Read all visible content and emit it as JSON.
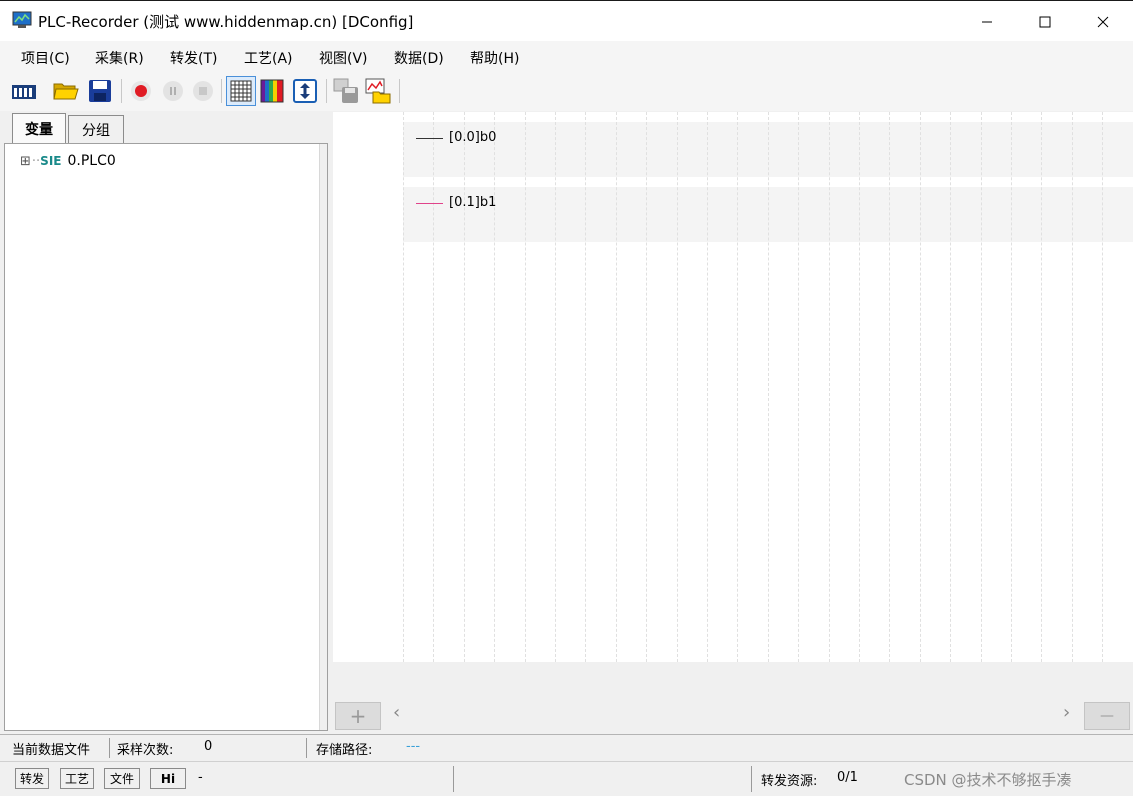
{
  "window": {
    "title": "PLC-Recorder (测试 www.hiddenmap.cn) [DConfig]",
    "minimize_glyph": "—",
    "maximize_glyph": "☐",
    "close_glyph": "✕"
  },
  "menu": [
    "项目(C)",
    "采集(R)",
    "转发(T)",
    "工艺(A)",
    "视图(V)",
    "数据(D)",
    "帮助(H)"
  ],
  "toolbar": {
    "icons": [
      "plc-device-icon",
      "open-folder-icon",
      "save-icon",
      "record-icon",
      "pause-icon",
      "stop-icon",
      "grid-icon",
      "color-palette-icon",
      "vertical-resize-icon",
      "save-data-icon",
      "chart-folder-icon"
    ]
  },
  "left_panel": {
    "tabs": [
      "变量",
      "分组"
    ],
    "tree": [
      {
        "expander": "⊞",
        "prefix": "SIE",
        "label": "0.PLC0"
      }
    ]
  },
  "chart": {
    "legend": [
      {
        "label": "[0.0]b0",
        "color": "#333333"
      },
      {
        "label": "[0.1]b1",
        "color": "#e0438a"
      }
    ],
    "add_button": "+",
    "remove_button": "—",
    "scroll_left": "‹",
    "scroll_right": "›"
  },
  "status": {
    "current_file_label": "当前数据文件",
    "sample_count_label": "采样次数:",
    "sample_count_value": "0",
    "storage_path_label": "存储路径:",
    "storage_path_value": "---",
    "boxes": [
      "转发",
      "工艺",
      "文件",
      "Hi"
    ],
    "dash": "-",
    "forward_resource_label": "转发资源:",
    "forward_resource_value": "0/1",
    "watermark": "CSDN @技术不够抠手凑"
  },
  "colors": {
    "accent_blue": "#1a5fb4",
    "record_red": "#e01b24",
    "path_cyan": "#3aa0d8"
  }
}
